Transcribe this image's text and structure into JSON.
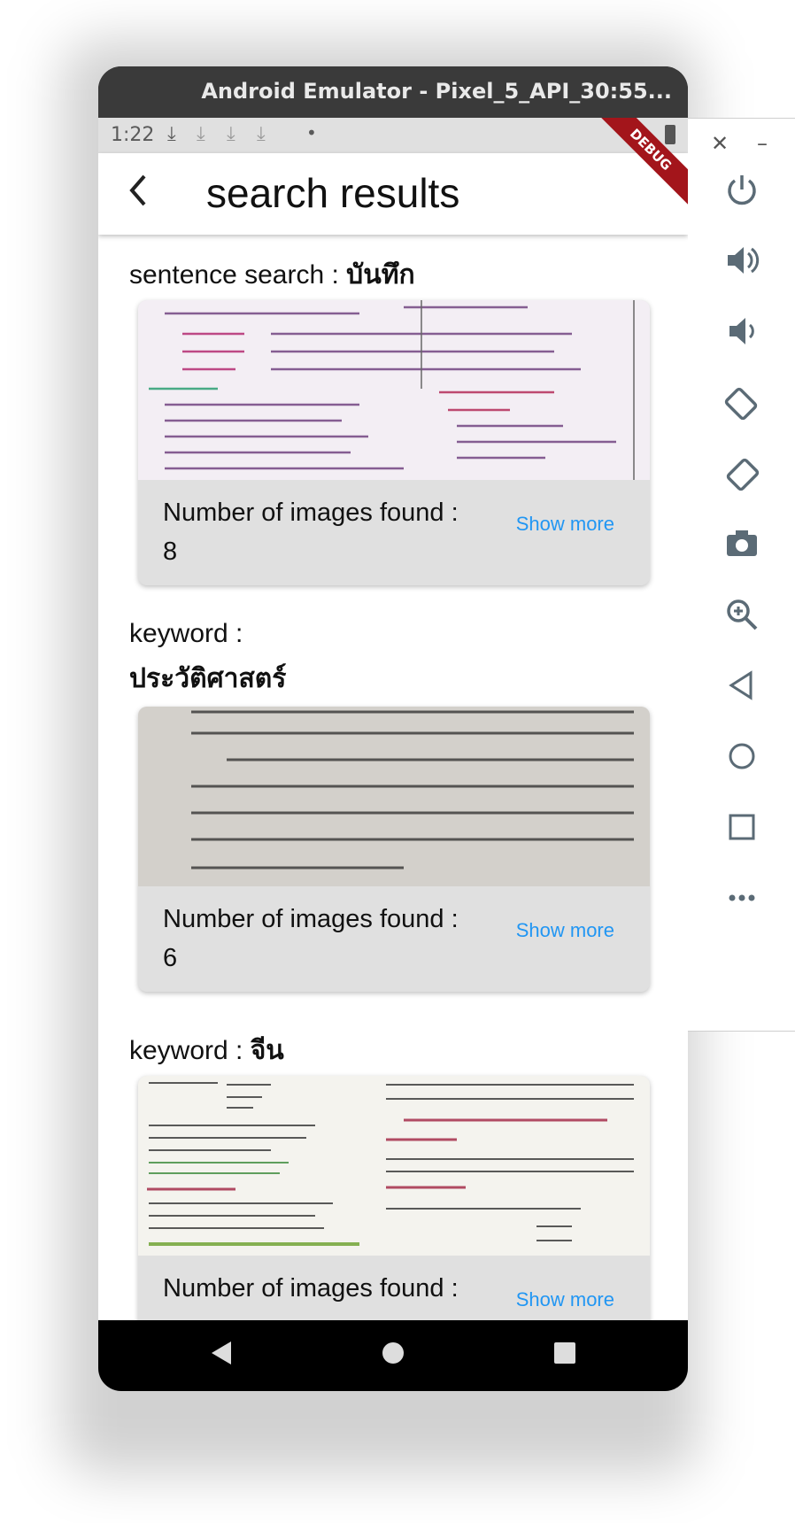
{
  "window": {
    "title": "Android Emulator - Pixel_5_API_30:55..."
  },
  "status_bar": {
    "time": "1:22"
  },
  "app_bar": {
    "title": "search results",
    "debug_banner": "DEBUG"
  },
  "sections": [
    {
      "prefix": "sentence search : ",
      "term": "บันทึก",
      "count_label": "Number of images found :",
      "count": "8",
      "action": "Show more"
    },
    {
      "prefix": "keyword :",
      "term": "ประวัติศาสตร์",
      "count_label": "Number of images found :",
      "count": "6",
      "action": "Show more"
    },
    {
      "prefix": "keyword : ",
      "term": "จีน",
      "count_label": "Number of images found :",
      "count": "",
      "action": "Show more"
    }
  ],
  "emulator_panel": {
    "icons": [
      "close-icon",
      "minimize-icon",
      "power-icon",
      "volume-up-icon",
      "volume-down-icon",
      "rotate-left-icon",
      "rotate-right-icon",
      "camera-icon",
      "zoom-icon",
      "back-icon",
      "home-icon",
      "overview-icon",
      "more-icon"
    ]
  },
  "nav_bar": {
    "icons": [
      "back-icon",
      "home-icon",
      "recents-icon"
    ]
  }
}
